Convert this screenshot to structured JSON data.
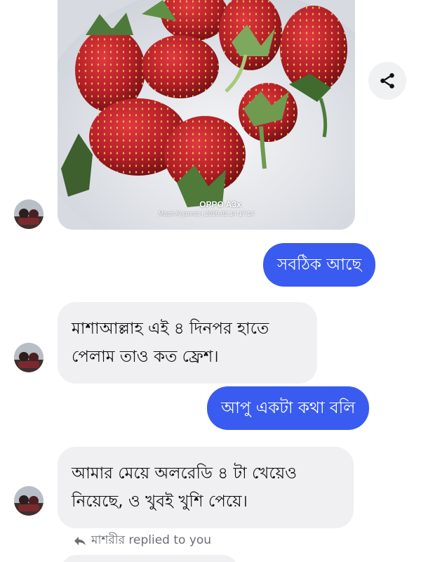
{
  "photo": {
    "watermark_brand": "OPPO A3x",
    "watermark_meta": "Masri Al jannat | 2025.02.14 17:14",
    "share_icon": "share-icon"
  },
  "messages": [
    {
      "direction": "outgoing",
      "text": "সবঠিক আছে"
    },
    {
      "direction": "incoming",
      "lines": [
        "মাশাআল্লাহ এই ৪ দিনপর হাতে",
        "পেলাম তাও কত ফ্রেশ।"
      ]
    },
    {
      "direction": "outgoing",
      "text": "আপু একটা কথা বলি"
    },
    {
      "direction": "incoming",
      "lines": [
        "আমার মেয়ে অলরেডি ৪ টা খেয়েও",
        "নিয়েছে, ও খুবই খুশি পেয়ে।"
      ]
    }
  ],
  "reply_note": {
    "text": "মাশরীর replied to you",
    "icon": "reply-arrow-icon"
  },
  "colors": {
    "outgoing_bubble": "#3a5bf0",
    "incoming_bubble": "#f0f0f2",
    "meta_text": "#6b6e73"
  }
}
